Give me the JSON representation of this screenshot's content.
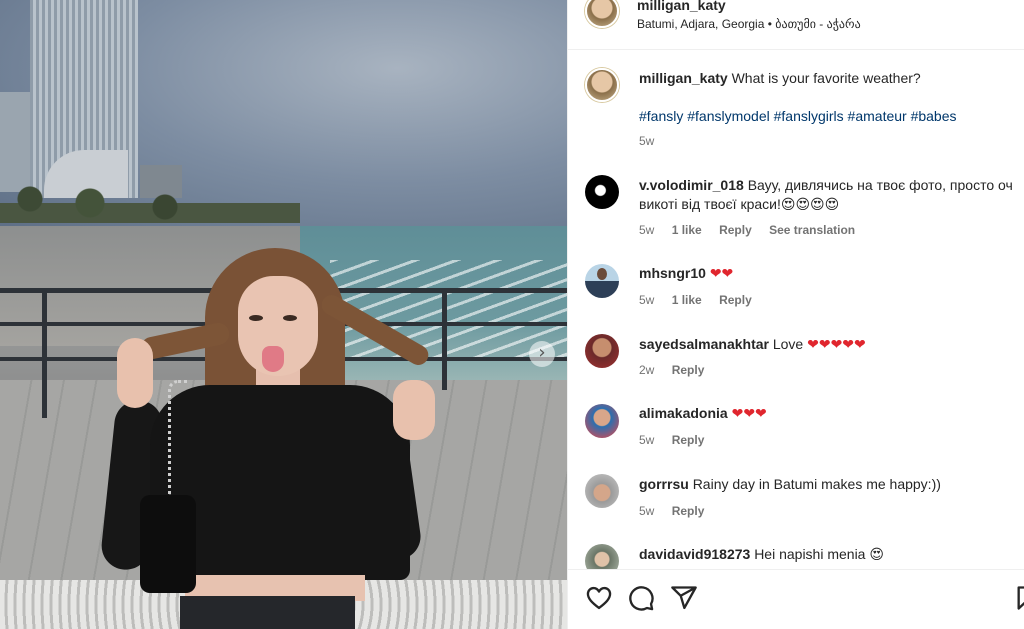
{
  "post": {
    "username": "milligan_katy",
    "location": "Batumi, Adjara, Georgia • ბათუმი - აჭარა",
    "caption": "What is your favorite weather?",
    "hashtags": "#fansly #fanslymodel #fanslygirls #amateur #babes",
    "time": "5w"
  },
  "comments": [
    {
      "user": "v.volodimir_018",
      "text": "Вауу, дивлячись на твоє фото, просто оч",
      "text2": "викоті від твоєї краси!",
      "emoji2": "😍😍😍😍",
      "time": "5w",
      "likes": "1 like",
      "reply": "Reply",
      "translate": "See translation"
    },
    {
      "user": "mhsngr10",
      "text": "",
      "hearts": "❤❤",
      "time": "5w",
      "likes": "1 like",
      "reply": "Reply"
    },
    {
      "user": "sayedsalmanakhtar",
      "text": "Love",
      "hearts": "❤❤❤❤❤",
      "time": "2w",
      "reply": "Reply"
    },
    {
      "user": "alimakadonia",
      "text": "",
      "hearts": "❤❤❤",
      "time": "5w",
      "reply": "Reply"
    },
    {
      "user": "gorrrsu",
      "text": "Rainy day in Batumi makes me happy:))",
      "time": "5w",
      "reply": "Reply"
    },
    {
      "user": "davidavid918273",
      "text": "Hei napishi menia",
      "emoji": "😍"
    }
  ],
  "icons": {
    "next": "chevron-right-icon",
    "like": "heart-icon",
    "comment": "comment-icon",
    "share": "paper-plane-icon",
    "save": "bookmark-icon"
  },
  "colors": {
    "link": "#00376b",
    "meta": "#737373",
    "heart": "#e0262e"
  }
}
